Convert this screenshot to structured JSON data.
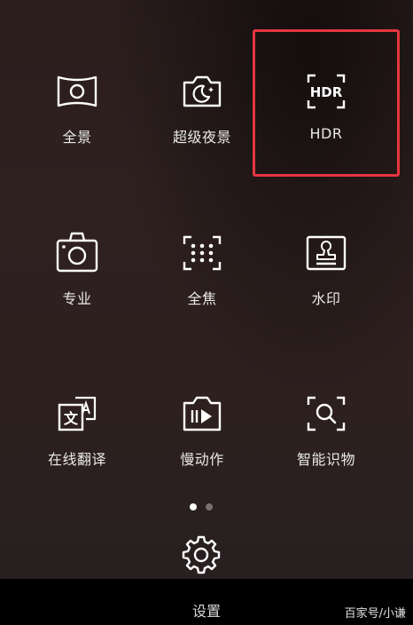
{
  "modes": [
    {
      "label": "全景",
      "icon": "panorama-icon"
    },
    {
      "label": "超级夜景",
      "icon": "night-mode-icon"
    },
    {
      "label": "HDR",
      "icon": "hdr-icon"
    },
    {
      "label": "专业",
      "icon": "pro-camera-icon"
    },
    {
      "label": "全焦",
      "icon": "all-focus-icon"
    },
    {
      "label": "水印",
      "icon": "watermark-icon"
    },
    {
      "label": "在线翻译",
      "icon": "translate-icon"
    },
    {
      "label": "慢动作",
      "icon": "slow-motion-icon"
    },
    {
      "label": "智能识物",
      "icon": "object-recognition-icon"
    }
  ],
  "hdr_icon_text": "HDR",
  "translate_icon_text": "文",
  "pagination": {
    "pages": 2,
    "current": 1
  },
  "settings": {
    "label": "设置",
    "icon": "gear-icon"
  },
  "watermark": "百家号/小谦",
  "colors": {
    "highlight": "#e5363f",
    "icon": "#ffffff",
    "bar": "#000000"
  }
}
